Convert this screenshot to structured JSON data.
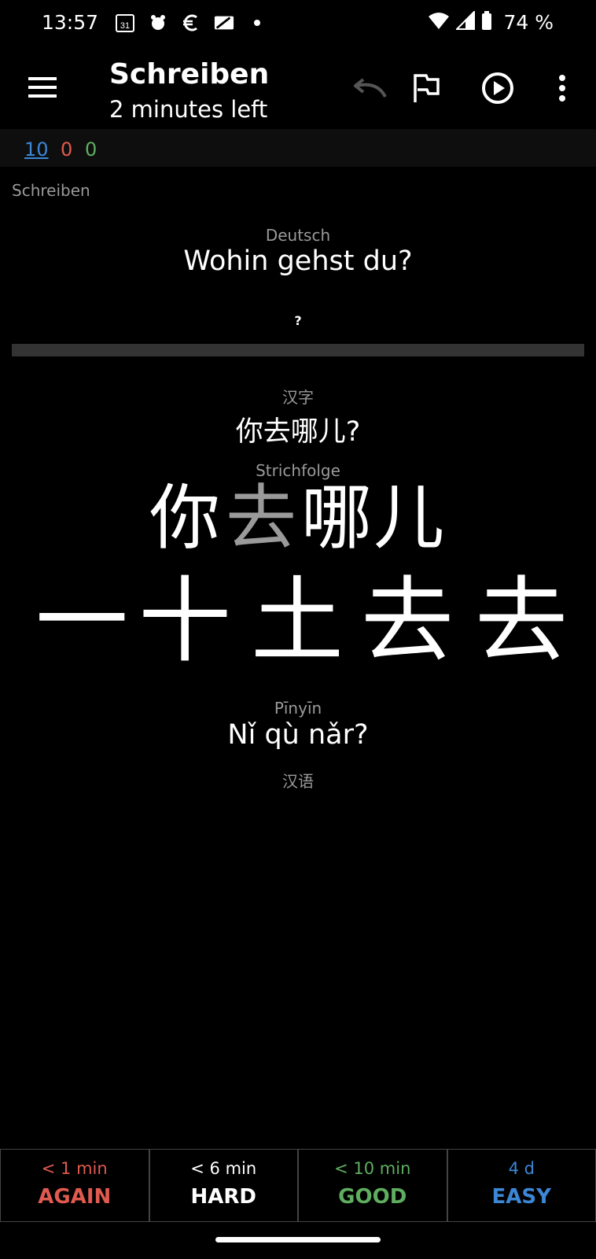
{
  "status_bar": {
    "time": "13:57",
    "calendar_day": "31",
    "battery_percent": "74 %",
    "icons": [
      "calendar-icon",
      "gear-bug-icon",
      "euro-icon",
      "cast-icon",
      "dot-icon",
      "wifi-icon",
      "signal-icon",
      "battery-icon"
    ]
  },
  "toolbar": {
    "title": "Schreiben",
    "subtitle": "2 minutes left",
    "icons": [
      "menu-icon",
      "undo-icon",
      "flag-icon",
      "play-icon",
      "more-icon"
    ]
  },
  "counts": {
    "new": "10",
    "learning": "0",
    "review": "0"
  },
  "card": {
    "deck_label": "Schreiben",
    "field1_label": "Deutsch",
    "field1_value": "Wohin gehst du?",
    "question_mark": "?",
    "field2_label": "汉字",
    "field2_value": "你去哪儿?",
    "field3_label": "Strichfolge",
    "stroke_chars": [
      "你",
      "去",
      "哪",
      "儿"
    ],
    "highlight_index": 1,
    "stroke_steps": [
      "一",
      "十",
      "土",
      "去",
      "去"
    ],
    "field4_label": "Pīnyīn",
    "field4_value": "Nǐ qù nǎr?",
    "field5_label": "汉语"
  },
  "answers": [
    {
      "interval": "< 1 min",
      "label": "AGAIN",
      "color": "#e05a4f",
      "label_color": "#e05a4f"
    },
    {
      "interval": "< 6 min",
      "label": "HARD",
      "color": "#ffffff",
      "label_color": "#ffffff"
    },
    {
      "interval": "< 10 min",
      "label": "GOOD",
      "color": "#5fae5f",
      "label_color": "#5fae5f"
    },
    {
      "interval": "4 d",
      "label": "EASY",
      "color": "#3b87d6",
      "label_color": "#3b87d6"
    }
  ]
}
